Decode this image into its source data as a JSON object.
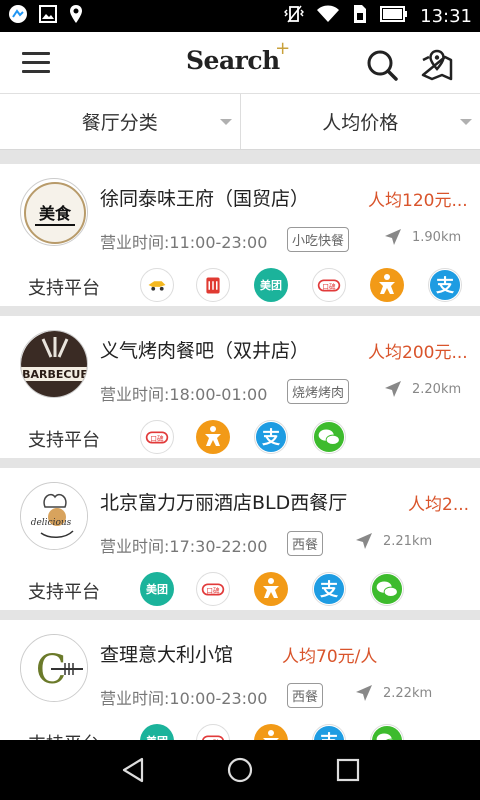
{
  "status_bar": {
    "time": "13:31",
    "left_icons": [
      "app-notification-icon",
      "image-icon",
      "location-pin-icon"
    ],
    "right_icons": [
      "vibrate-icon",
      "wifi-icon",
      "sim-icon",
      "battery-icon"
    ]
  },
  "header": {
    "logo_text": "Search",
    "logo_plus": "+",
    "icons": [
      "menu-icon",
      "search-icon",
      "map-pin-icon"
    ]
  },
  "filters": [
    {
      "label": "餐厅分类"
    },
    {
      "label": "人均价格"
    }
  ],
  "restaurants": [
    {
      "logo_text": "美食",
      "name": "徐同泰味王府（国贸店）",
      "price": "人均120元...",
      "hours": "营业时间:11:00-23:00",
      "tag": "小吃快餐",
      "distance": "1.90km",
      "platform_label": "支持平台",
      "platforms": [
        {
          "type": "bdwm",
          "label": ""
        },
        {
          "type": "dzxw",
          "label": ""
        },
        {
          "type": "meituan",
          "label": "美团"
        },
        {
          "type": "koubei",
          "label": "口碑"
        },
        {
          "type": "ele",
          "label": ""
        },
        {
          "type": "ali",
          "label": "支"
        }
      ]
    },
    {
      "logo_text": "BARBECUE",
      "name": "义气烤肉餐吧（双井店）",
      "price": "人均200元...",
      "hours": "营业时间:18:00-01:00",
      "tag": "烧烤烤肉",
      "distance": "2.20km",
      "platform_label": "支持平台",
      "platforms": [
        {
          "type": "koubei",
          "label": "口碑"
        },
        {
          "type": "ele",
          "label": ""
        },
        {
          "type": "ali",
          "label": "支"
        },
        {
          "type": "wechat",
          "label": ""
        }
      ]
    },
    {
      "logo_text": "delicious",
      "name": "北京富力万丽酒店BLD西餐厅",
      "price": "人均2...",
      "hours": "营业时间:17:30-22:00",
      "tag": "西餐",
      "distance": "2.21km",
      "platform_label": "支持平台",
      "platforms": [
        {
          "type": "meituan",
          "label": "美团"
        },
        {
          "type": "koubei",
          "label": "口碑"
        },
        {
          "type": "ele",
          "label": ""
        },
        {
          "type": "ali",
          "label": "支"
        },
        {
          "type": "wechat",
          "label": ""
        }
      ]
    },
    {
      "logo_text": "C",
      "name": "查理意大利小馆",
      "price": "人均70元/人",
      "hours": "营业时间:10:00-23:00",
      "tag": "西餐",
      "distance": "2.22km",
      "platform_label": "支持平台",
      "platforms": [
        {
          "type": "meituan",
          "label": "美团"
        },
        {
          "type": "koubei",
          "label": "口碑"
        },
        {
          "type": "ele",
          "label": ""
        },
        {
          "type": "ali",
          "label": "支"
        },
        {
          "type": "wechat",
          "label": ""
        }
      ]
    }
  ],
  "nav_bar": {
    "icons": [
      "back-icon",
      "home-icon",
      "recents-icon"
    ]
  },
  "colors": {
    "price": "#d9542b",
    "meituan": "#1bb39b",
    "ele": "#f29a17",
    "alipay": "#1e9ce2",
    "wechat": "#3dbb2d",
    "koubei": "#e13a3a"
  }
}
